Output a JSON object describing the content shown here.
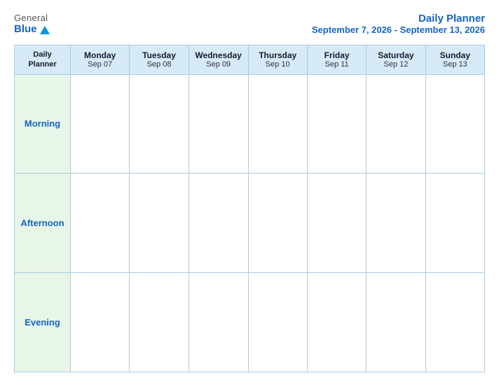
{
  "logo": {
    "general": "General",
    "blue": "Blue",
    "icon": "triangle"
  },
  "header": {
    "title": "Daily Planner",
    "subtitle": "September 7, 2026 - September 13, 2026"
  },
  "table": {
    "header_col": {
      "line1": "Daily",
      "line2": "Planner"
    },
    "days": [
      {
        "name": "Monday",
        "date": "Sep 07"
      },
      {
        "name": "Tuesday",
        "date": "Sep 08"
      },
      {
        "name": "Wednesday",
        "date": "Sep 09"
      },
      {
        "name": "Thursday",
        "date": "Sep 10"
      },
      {
        "name": "Friday",
        "date": "Sep 11"
      },
      {
        "name": "Saturday",
        "date": "Sep 12"
      },
      {
        "name": "Sunday",
        "date": "Sep 13"
      }
    ],
    "rows": [
      {
        "label": "Morning"
      },
      {
        "label": "Afternoon"
      },
      {
        "label": "Evening"
      }
    ]
  }
}
